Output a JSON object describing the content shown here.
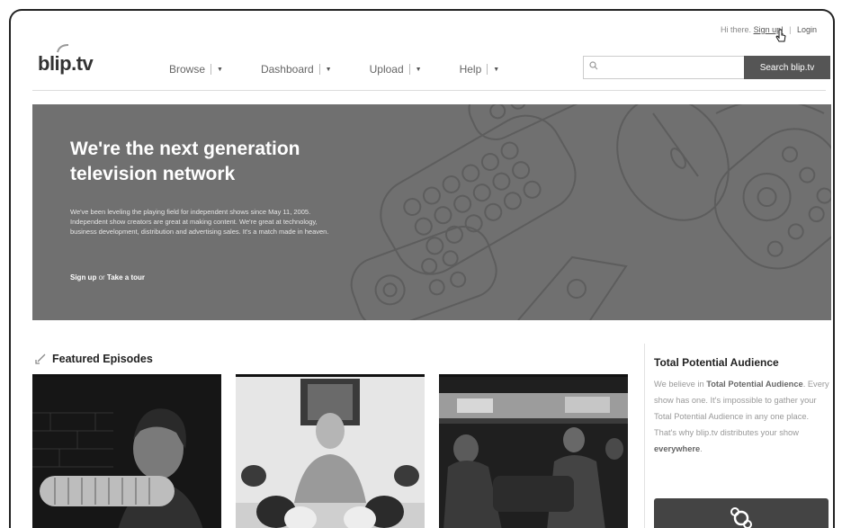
{
  "header": {
    "greeting": "Hi there.",
    "signup": "Sign up!",
    "separator": "|",
    "login": "Login",
    "logo": "blip.tv",
    "search_placeholder": "",
    "search_button": "Search blip.tv"
  },
  "nav": [
    {
      "label": "Browse"
    },
    {
      "label": "Dashboard"
    },
    {
      "label": "Upload"
    },
    {
      "label": "Help"
    }
  ],
  "hero": {
    "title": "We're the next generation television network",
    "body": "We've been leveling the playing field for independent shows since May 11, 2005. Independent show creators are great at making content. We're great at technology, business development, distribution and advertising sales. It's a match made in heaven.",
    "cta_signup": "Sign up",
    "cta_or": "or",
    "cta_tour": "Take a tour"
  },
  "featured": {
    "heading": "Featured Episodes"
  },
  "sidebar": {
    "title": "Total Potential Audience",
    "p1": "We believe in ",
    "p1_bold": "Total Potential Audience",
    "p2": ". Every show has one. It's impossible to gather your Total Potential Audience in any one place. That's why blip.tv distributes your show ",
    "p2_bold": "everywhere",
    "p3": "."
  },
  "colors": {
    "hero_bg": "#707070",
    "search_button_bg": "#555555"
  }
}
